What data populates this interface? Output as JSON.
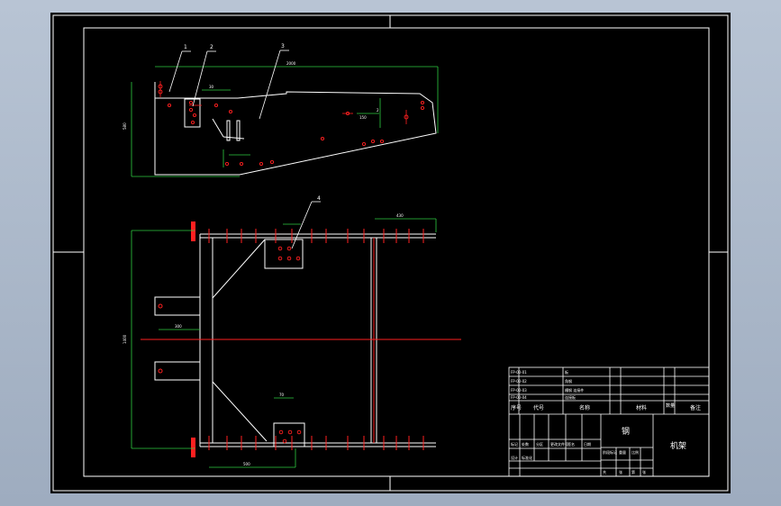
{
  "drawing": {
    "balloons": [
      "1",
      "2",
      "3",
      "4"
    ],
    "dims": {
      "top_overall": "2000",
      "left_height": "580",
      "right_a": "2",
      "right_b": "150",
      "small_a": "30",
      "plan_top_right": "430",
      "plan_left_height": "1400",
      "plan_bracket_width": "300",
      "plan_bottom": "500",
      "plan_bottom_small": "70"
    }
  },
  "title_block": {
    "labels": {
      "seq": "序号",
      "code": "代号",
      "name": "名称",
      "material": "材料",
      "qty": "数量",
      "remark": "备注"
    },
    "parts": [
      {
        "code": "FP-00-01",
        "name": "板"
      },
      {
        "code": "FP-00-02",
        "name": "角钢"
      },
      {
        "code": "FP-00-03",
        "name": "槽钢 连接件"
      },
      {
        "code": "FP-00-04",
        "name": "连接板"
      }
    ],
    "material_big": "钢",
    "drawing_name": "机架",
    "sign_row": [
      "标记",
      "处数",
      "分区",
      "更改文件号",
      "签名",
      "日期"
    ],
    "stage_row": [
      "阶段标记",
      "重量",
      "比例"
    ],
    "approve_row": [
      "设计",
      "标准化"
    ],
    "sheet_row": [
      "共",
      "张",
      "第",
      "张"
    ]
  }
}
